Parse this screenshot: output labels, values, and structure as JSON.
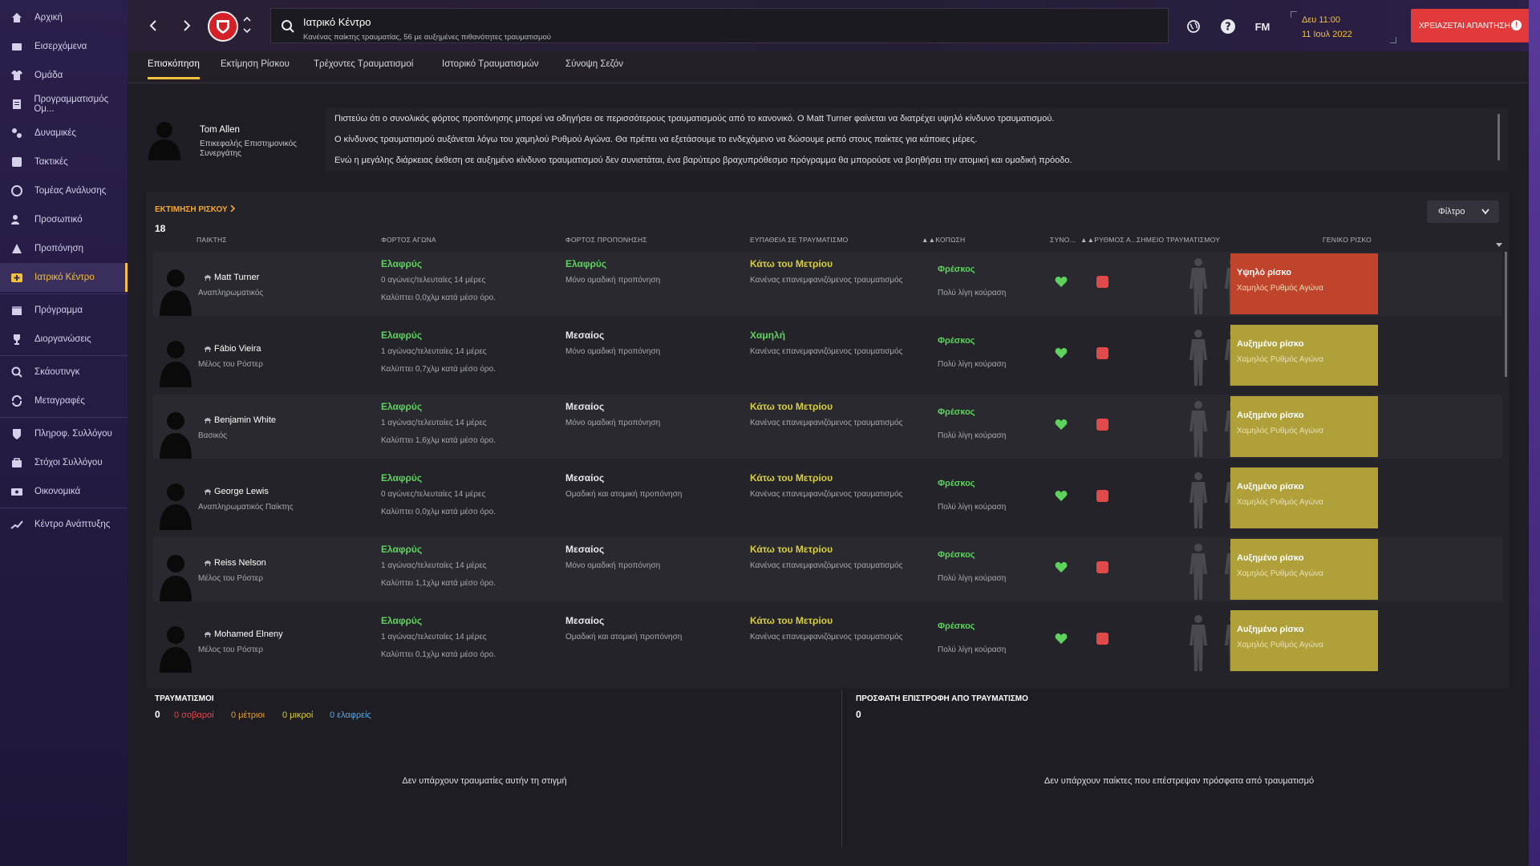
{
  "sidebar": {
    "items": [
      {
        "label": "Αρχική",
        "icon": "home-icon"
      },
      {
        "label": "Εισερχόμενα",
        "icon": "inbox-icon"
      },
      {
        "label": "Ομάδα",
        "icon": "shirt-icon"
      },
      {
        "label": "Προγραμματισμός Ομ...",
        "icon": "clipboard-icon"
      },
      {
        "label": "Δυναμικές",
        "icon": "dynamics-icon"
      },
      {
        "label": "Τακτικές",
        "icon": "tactics-icon"
      },
      {
        "label": "Τομέας Ανάλυσης",
        "icon": "analysis-icon"
      },
      {
        "label": "Προσωπικό",
        "icon": "staff-icon"
      },
      {
        "label": "Προπόνηση",
        "icon": "training-icon"
      },
      {
        "label": "Ιατρικό Κέντρο",
        "icon": "medical-icon",
        "active": true
      },
      {
        "label": "Πρόγραμμα",
        "icon": "calendar-icon"
      },
      {
        "label": "Διοργανώσεις",
        "icon": "trophy-icon"
      },
      {
        "label": "Σκάουτινγκ",
        "icon": "scouting-icon"
      },
      {
        "label": "Μεταγραφές",
        "icon": "transfers-icon"
      },
      {
        "label": "Πληροφ. Συλλόγου",
        "icon": "club-info-icon"
      },
      {
        "label": "Στόχοι Συλλόγου",
        "icon": "goals-icon"
      },
      {
        "label": "Οικονομικά",
        "icon": "finances-icon"
      },
      {
        "label": "Κέντρο Ανάπτυξης",
        "icon": "development-icon"
      }
    ]
  },
  "header": {
    "title": "Ιατρικό Κέντρο",
    "subtitle": "Κανένας παίκτης τραυματίας, 56 με αυξημένες πιθανότητες τραυματισμού",
    "logo": "FM",
    "date_time": "Δευ 11:00",
    "date_day": "11 Ιουλ 2022",
    "continue_label": "ΧΡΕΙΑΖΕΤΑΙ ΑΠΑΝΤΗΣΗ"
  },
  "tabs": [
    {
      "label": "Επισκόπηση",
      "active": true
    },
    {
      "label": "Εκτίμηση Ρίσκου"
    },
    {
      "label": "Τρέχοντες Τραυματισμοί"
    },
    {
      "label": "Ιστορικό Τραυματισμών"
    },
    {
      "label": "Σύνοψη Σεζόν"
    }
  ],
  "advisor": {
    "name": "Tom Allen",
    "role": "Επικεφαλής Επιστημονικός Συνεργάτης",
    "lines": [
      "Πιστεύω ότι ο συνολικός φόρτος προπόνησης μπορεί να οδηγήσει σε περισσότερους τραυματισμούς από το κανονικό. Ο Matt Turner φαίνεται να διατρέχει υψηλό κίνδυνο τραυματισμού.",
      "Ο κίνδυνος τραυματισμού αυξάνεται λόγω του χαμηλού Ρυθμού Αγώνα. Θα πρέπει να εξετάσουμε το ενδεχόμενο να δώσουμε ρεπό στους παίκτες για κάποιες μέρες.",
      "Ενώ η μεγάλης διάρκειας έκθεση σε αυξημένο κίνδυνο τραυματισμού δεν συνιστάται, ένα βαρύτερο βραχυπρόθεσμο πρόγραμμα θα μπορούσε να βοηθήσει την ατομική και ομαδική πρόοδο."
    ]
  },
  "risk": {
    "heading": "ΕΚΤΙΜΗΣΗ ΡΙΣΚΟΥ",
    "count": "18",
    "filter_label": "Φίλτρο",
    "columns": {
      "player": "ΠΑΙΚΤΗΣ",
      "match_load": "ΦΟΡΤΟΣ ΑΓΩΝΑ",
      "training_load": "ΦΟΡΤΟΣ ΠΡΟΠΟΝΗΣΗΣ",
      "susceptibility": "ΕΥΠΑΘΕΙΑ ΣΕ ΤΡΑΥΜΑΤΙΣΜΟ",
      "fatigue": "ΚΟΠΩΣΗ",
      "condition": "ΣΥΝΟ...",
      "sharpness": "ΡΥΘΜΟΣ Α...",
      "injury_point": "ΣΗΜΕΙΟ ΤΡΑΥΜΑΤΙΣΜΟΥ",
      "overall": "ΓΕΝΙΚΟ ΡΙΣΚΟ"
    },
    "rows": [
      {
        "name": "Matt Turner",
        "role": "Αναπληρωματικός",
        "match_load": "Ελαφρύς",
        "match_sub1": "0 αγώνες/τελευταίες 14 μέρες",
        "match_sub2": "Καλύπτει 0,0χλμ κατά μέσο όρο.",
        "training_load": "Ελαφρύς",
        "training_sub": "Μόνο ομαδική προπόνηση",
        "suscept": "Κάτω του Μετρίου",
        "suscept_sub": "Κανένας επανεμφανιζόμενος τραυματισμός",
        "fatigue": "Φρέσκος",
        "fatigue_sub": "Πολύ λίγη κούραση",
        "overall": "Υψηλό ρίσκο",
        "overall_sub": "Χαμηλός Ρυθμός Αγώνα"
      },
      {
        "name": "Fábio Vieira",
        "role": "Μέλος του Ρόστερ",
        "match_load": "Ελαφρύς",
        "match_sub1": "1 αγώνας/τελευταίες 14 μέρες",
        "match_sub2": "Καλύπτει 0,7χλμ κατά μέσο όρο.",
        "training_load": "Μεσαίος",
        "training_sub": "Μόνο ομαδική προπόνηση",
        "suscept": "Χαμηλή",
        "suscept_sub": "Κανένας επανεμφανιζόμενος τραυματισμός",
        "fatigue": "Φρέσκος",
        "fatigue_sub": "Πολύ λίγη κούραση",
        "overall": "Αυξημένο ρίσκο",
        "overall_sub": "Χαμηλός Ρυθμός Αγώνα"
      },
      {
        "name": "Benjamin White",
        "role": "Βασικός",
        "match_load": "Ελαφρύς",
        "match_sub1": "1 αγώνας/τελευταίες 14 μέρες",
        "match_sub2": "Καλύπτει 1,6χλμ κατά μέσο όρο.",
        "training_load": "Μεσαίος",
        "training_sub": "Μόνο ομαδική προπόνηση",
        "suscept": "Κάτω του Μετρίου",
        "suscept_sub": "Κανένας επανεμφανιζόμενος τραυματισμός",
        "fatigue": "Φρέσκος",
        "fatigue_sub": "Πολύ λίγη κούραση",
        "overall": "Αυξημένο ρίσκο",
        "overall_sub": "Χαμηλός Ρυθμός Αγώνα"
      },
      {
        "name": "George Lewis",
        "role": "Αναπληρωματικός Παίκτης",
        "match_load": "Ελαφρύς",
        "match_sub1": "0 αγώνες/τελευταίες 14 μέρες",
        "match_sub2": "Καλύπτει 0,0χλμ κατά μέσο όρο.",
        "training_load": "Μεσαίος",
        "training_sub": "Ομαδική και ατομική προπόνηση",
        "suscept": "Κάτω του Μετρίου",
        "suscept_sub": "Κανένας επανεμφανιζόμενος τραυματισμός",
        "fatigue": "Φρέσκος",
        "fatigue_sub": "Πολύ λίγη κούραση",
        "overall": "Αυξημένο ρίσκο",
        "overall_sub": "Χαμηλός Ρυθμός Αγώνα"
      },
      {
        "name": "Reiss Nelson",
        "role": "Μέλος του Ρόστερ",
        "match_load": "Ελαφρύς",
        "match_sub1": "1 αγώνας/τελευταίες 14 μέρες",
        "match_sub2": "Καλύπτει 1,1χλμ κατά μέσο όρο.",
        "training_load": "Μεσαίος",
        "training_sub": "Μόνο ομαδική προπόνηση",
        "suscept": "Κάτω του Μετρίου",
        "suscept_sub": "Κανένας επανεμφανιζόμενος τραυματισμός",
        "fatigue": "Φρέσκος",
        "fatigue_sub": "Πολύ λίγη κούραση",
        "overall": "Αυξημένο ρίσκο",
        "overall_sub": "Χαμηλός Ρυθμός Αγώνα"
      },
      {
        "name": "Mohamed Elneny",
        "role": "Μέλος του Ρόστερ",
        "match_load": "Ελαφρύς",
        "match_sub1": "1 αγώνας/τελευταίες 14 μέρες",
        "match_sub2": "Καλύπτει 0,1χλμ κατά μέσο όρο.",
        "training_load": "Μεσαίος",
        "training_sub": "Ομαδική και ατομική προπόνηση",
        "suscept": "Κάτω του Μετρίου",
        "suscept_sub": "Κανένας επανεμφανιζόμενος τραυματισμός",
        "fatigue": "Φρέσκος",
        "fatigue_sub": "Πολύ λίγη κούραση",
        "overall": "Αυξημένο ρίσκο",
        "overall_sub": "Χαμηλός Ρυθμός Αγώνα"
      }
    ]
  },
  "injuries": {
    "heading": "ΤΡΑΥΜΑΤΙΣΜΟΙ",
    "count": "0",
    "serious": "0 σοβαροί",
    "medium": "0 μέτριοι",
    "minor": "0 μικροί",
    "light": "0 ελαφρείς",
    "empty": "Δεν υπάρχουν τραυματίες αυτήν τη στιγμή"
  },
  "recent": {
    "heading": "ΠΡΟΣΦΑΤΗ ΕΠΙΣΤΡΟΦΗ ΑΠΟ ΤΡΑΥΜΑΤΙΣΜΟ",
    "count": "0",
    "empty": "Δεν υπάρχουν παίκτες που επέστρεψαν πρόσφατα από τραυματισμό"
  },
  "colors": {
    "accent": "#f4c13a",
    "high_risk": "#c0442c",
    "increased_risk": "#b0a03a",
    "good": "#5dd35d",
    "alert": "#e23a3a"
  }
}
